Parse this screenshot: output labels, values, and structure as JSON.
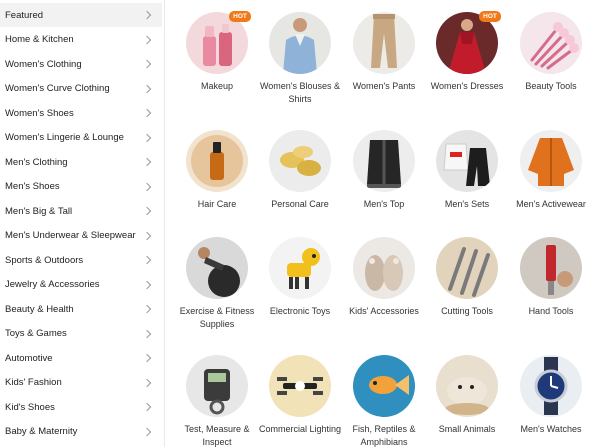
{
  "sidebar": {
    "items": [
      {
        "label": "Featured"
      },
      {
        "label": "Home & Kitchen"
      },
      {
        "label": "Women's Clothing"
      },
      {
        "label": "Women's Curve Clothing"
      },
      {
        "label": "Women's Shoes"
      },
      {
        "label": "Women's Lingerie & Lounge"
      },
      {
        "label": "Men's Clothing"
      },
      {
        "label": "Men's Shoes"
      },
      {
        "label": "Men's Big & Tall"
      },
      {
        "label": "Men's Underwear & Sleepwear"
      },
      {
        "label": "Sports & Outdoors"
      },
      {
        "label": "Jewelry & Accessories"
      },
      {
        "label": "Beauty & Health"
      },
      {
        "label": "Toys & Games"
      },
      {
        "label": "Automotive"
      },
      {
        "label": "Kids' Fashion"
      },
      {
        "label": "Kid's Shoes"
      },
      {
        "label": "Baby & Maternity"
      }
    ]
  },
  "badges": {
    "hot": "HOT"
  },
  "categories": [
    {
      "label": "Makeup",
      "hot": true
    },
    {
      "label": "Women's Blouses & Shirts"
    },
    {
      "label": "Women's Pants"
    },
    {
      "label": "Women's Dresses",
      "hot": true
    },
    {
      "label": "Beauty Tools"
    },
    {
      "label": "Hair Care"
    },
    {
      "label": "Personal Care"
    },
    {
      "label": "Men's Top"
    },
    {
      "label": "Men's Sets"
    },
    {
      "label": "Men's Activewear"
    },
    {
      "label": "Exercise & Fitness Supplies"
    },
    {
      "label": "Electronic Toys"
    },
    {
      "label": "Kids' Accessories"
    },
    {
      "label": "Cutting Tools"
    },
    {
      "label": "Hand Tools"
    },
    {
      "label": "Test, Measure & Inspect"
    },
    {
      "label": "Commercial Lighting"
    },
    {
      "label": "Fish, Reptiles & Amphibians"
    },
    {
      "label": "Small Animals"
    },
    {
      "label": "Men's Watches"
    }
  ],
  "colors": {
    "hot_badge": "#f07a1a",
    "active_item_bg": "#f2f2f2"
  }
}
